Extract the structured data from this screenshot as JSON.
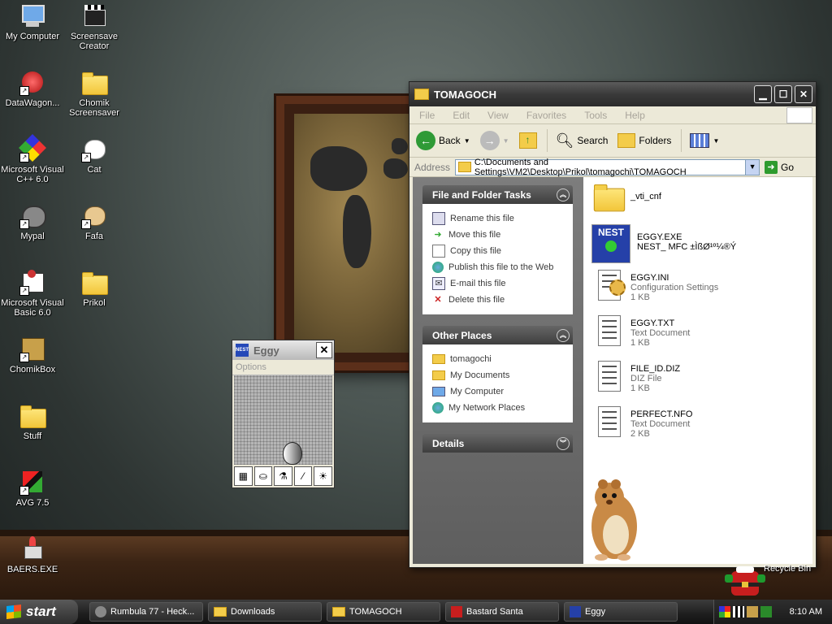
{
  "desktop": {
    "icons": [
      {
        "label": "My Computer"
      },
      {
        "label": "Screensave Creator"
      },
      {
        "label": "DataWagon..."
      },
      {
        "label": "Chomik Screensaver"
      },
      {
        "label": "Microsoft Visual C++ 6.0"
      },
      {
        "label": "Cat"
      },
      {
        "label": "Mypal"
      },
      {
        "label": "Fafa"
      },
      {
        "label": "Microsoft Visual Basic 6.0"
      },
      {
        "label": "Prikol"
      },
      {
        "label": "ChomikBox"
      },
      {
        "label": "Stuff"
      },
      {
        "label": "AVG 7.5"
      },
      {
        "label": "BAERS.EXE"
      }
    ],
    "recycle_bin_label": "Recycle Bin"
  },
  "explorer": {
    "title": "TOMAGOCH",
    "menu": [
      "File",
      "Edit",
      "View",
      "Favorites",
      "Tools",
      "Help"
    ],
    "toolbar": {
      "back": "Back",
      "search": "Search",
      "folders": "Folders"
    },
    "address_label": "Address",
    "address_value": "C:\\Documents and Settings\\VM2\\Desktop\\Prikol\\tomagochi\\TOMAGOCH",
    "go_label": "Go",
    "tasks_panel": {
      "title": "File and Folder Tasks",
      "items": [
        "Rename this file",
        "Move this file",
        "Copy this file",
        "Publish this file to the Web",
        "E-mail this file",
        "Delete this file"
      ]
    },
    "places_panel": {
      "title": "Other Places",
      "items": [
        "tomagochi",
        "My Documents",
        "My Computer",
        "My Network Places"
      ]
    },
    "details_panel": {
      "title": "Details"
    },
    "files": [
      {
        "name": "_vti_cnf",
        "type": "",
        "size": ""
      },
      {
        "name": "EGGY.EXE",
        "type": "NEST_ MFC ±ÌßØ¹º¼®Ý",
        "size": ""
      },
      {
        "name": "EGGY.INI",
        "type": "Configuration Settings",
        "size": "1 KB"
      },
      {
        "name": "EGGY.TXT",
        "type": "Text Document",
        "size": "1 KB"
      },
      {
        "name": "FILE_ID.DIZ",
        "type": "DIZ File",
        "size": "1 KB"
      },
      {
        "name": "PERFECT.NFO",
        "type": "Text Document",
        "size": "2 KB"
      }
    ]
  },
  "eggy": {
    "title": "Eggy",
    "menu": "Options",
    "icon_text": "NEST"
  },
  "taskbar": {
    "start": "start",
    "buttons": [
      "Rumbula 77 - Heck...",
      "Downloads",
      "TOMAGOCH",
      "Bastard Santa",
      "Eggy"
    ],
    "clock": "8:10 AM"
  }
}
